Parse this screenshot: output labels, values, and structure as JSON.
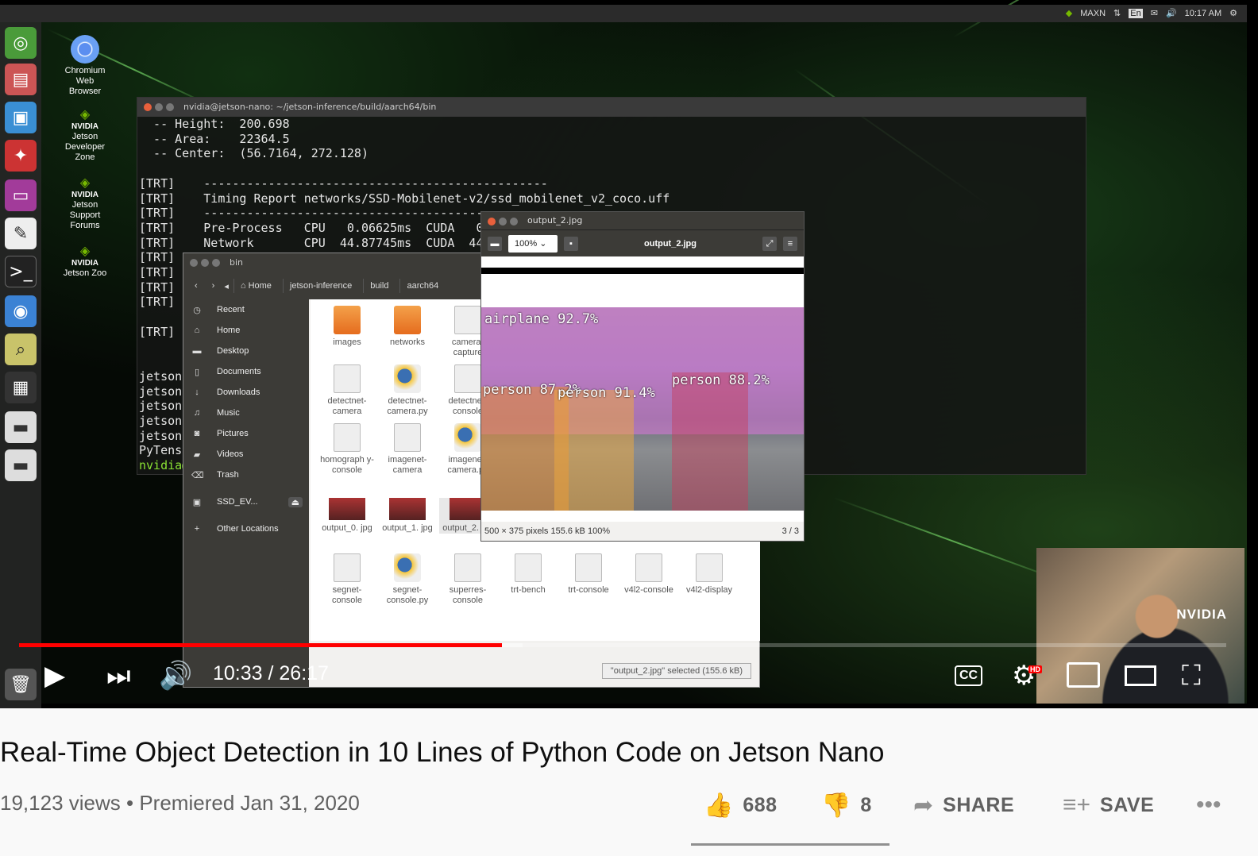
{
  "topbar": {
    "power_mode": "MAXN",
    "keyboard": "En",
    "clock": "10:17 AM"
  },
  "desktop_icons": [
    {
      "label_lines": [
        "Chromium",
        "Web",
        "Browser"
      ]
    },
    {
      "brand": "NVIDIA",
      "label_lines": [
        "Jetson",
        "Developer",
        "Zone"
      ]
    },
    {
      "brand": "NVIDIA",
      "label_lines": [
        "Jetson",
        "Support",
        "Forums"
      ]
    },
    {
      "brand": "NVIDIA",
      "label_lines": [
        "Jetson Zoo"
      ]
    }
  ],
  "terminal": {
    "title": "nvidia@jetson-nano: ~/jetson-inference/build/aarch64/bin",
    "lines": [
      "  -- Height:  200.698",
      "  -- Area:    22364.5",
      "  -- Center:  (56.7164, 272.128)",
      "",
      "[TRT]    ------------------------------------------------",
      "[TRT]    Timing Report networks/SSD-Mobilenet-v2/ssd_mobilenet_v2_coco.uff",
      "[TRT]    ------------------------------------------------",
      "[TRT]    Pre-Process   CPU   0.06625ms  CUDA   0.",
      "[TRT]    Network       CPU  44.87745ms  CUDA  44.",
      "[TRT]",
      "[TRT]",
      "[TRT]",
      "[TRT]",
      "",
      "[TRT]",
      "",
      "",
      "jetson",
      "jetson",
      "jetson",
      "jetson",
      "jetson",
      "PyTens"
    ],
    "prompt": "nvidia@"
  },
  "file_manager": {
    "title": "bin",
    "breadcrumbs": [
      "Home",
      "jetson-inference",
      "build",
      "aarch64"
    ],
    "sidebar": [
      {
        "icon": "clock-icon",
        "label": "Recent"
      },
      {
        "icon": "home-icon",
        "label": "Home"
      },
      {
        "icon": "folder-icon",
        "label": "Desktop"
      },
      {
        "icon": "document-icon",
        "label": "Documents"
      },
      {
        "icon": "download-icon",
        "label": "Downloads"
      },
      {
        "icon": "music-icon",
        "label": "Music"
      },
      {
        "icon": "camera-icon",
        "label": "Pictures"
      },
      {
        "icon": "video-icon",
        "label": "Videos"
      },
      {
        "icon": "trash-icon",
        "label": "Trash"
      },
      {
        "icon": "drive-icon",
        "label": "SSD_EV..."
      },
      {
        "icon": "plus-icon",
        "label": "Other Locations"
      }
    ],
    "files": [
      {
        "type": "folder",
        "name": "images"
      },
      {
        "type": "folder",
        "name": "networks"
      },
      {
        "type": "doc",
        "name": "camera-capture"
      },
      {
        "type": "doc",
        "name": "detectnet-camera"
      },
      {
        "type": "py",
        "name": "detectnet-camera.py"
      },
      {
        "type": "doc",
        "name": "detectnet-console"
      },
      {
        "type": "doc",
        "name": "homograph y-console"
      },
      {
        "type": "doc",
        "name": "imagenet-camera"
      },
      {
        "type": "py",
        "name": "imagenet-camera.py"
      },
      {
        "type": "thumb",
        "name": "output_0. jpg"
      },
      {
        "type": "thumb",
        "name": "output_1. jpg"
      },
      {
        "type": "thumb",
        "name": "output_2. jpg"
      },
      {
        "type": "doc",
        "name": "segnet-console"
      },
      {
        "type": "py",
        "name": "segnet-console.py"
      },
      {
        "type": "doc",
        "name": "superres-console"
      },
      {
        "type": "doc",
        "name": "trt-bench"
      },
      {
        "type": "doc",
        "name": "trt-console"
      },
      {
        "type": "doc",
        "name": "v4l2-console"
      },
      {
        "type": "doc",
        "name": "v4l2-display"
      }
    ],
    "status": "\"output_2.jpg\" selected (155.6 kB)"
  },
  "image_viewer": {
    "window_title": "output_2.jpg",
    "zoom": "100%",
    "filename": "output_2.jpg",
    "detections": [
      {
        "label": "airplane 92.7%"
      },
      {
        "label": "person 87.2%"
      },
      {
        "label": "person 91.4%"
      },
      {
        "label": "person 88.2%"
      }
    ],
    "status_info": "500 × 375 pixels  155.6 kB   100%",
    "page": "3 / 3"
  },
  "webcam": {
    "logo": "NVIDIA"
  },
  "player": {
    "time": "10:33 / 26:17",
    "played_fraction": 0.4,
    "buffered_fraction": 0.417,
    "hd_badge": "HD",
    "colors": {
      "progress": "#ff0000"
    }
  },
  "video": {
    "title": "Real-Time Object Detection in 10 Lines of Python Code on Jetson Nano",
    "views": "19,123 views",
    "separator": "•",
    "date": "Premiered Jan 31, 2020",
    "likes": "688",
    "dislikes": "8",
    "share_label": "SHARE",
    "save_label": "SAVE"
  }
}
